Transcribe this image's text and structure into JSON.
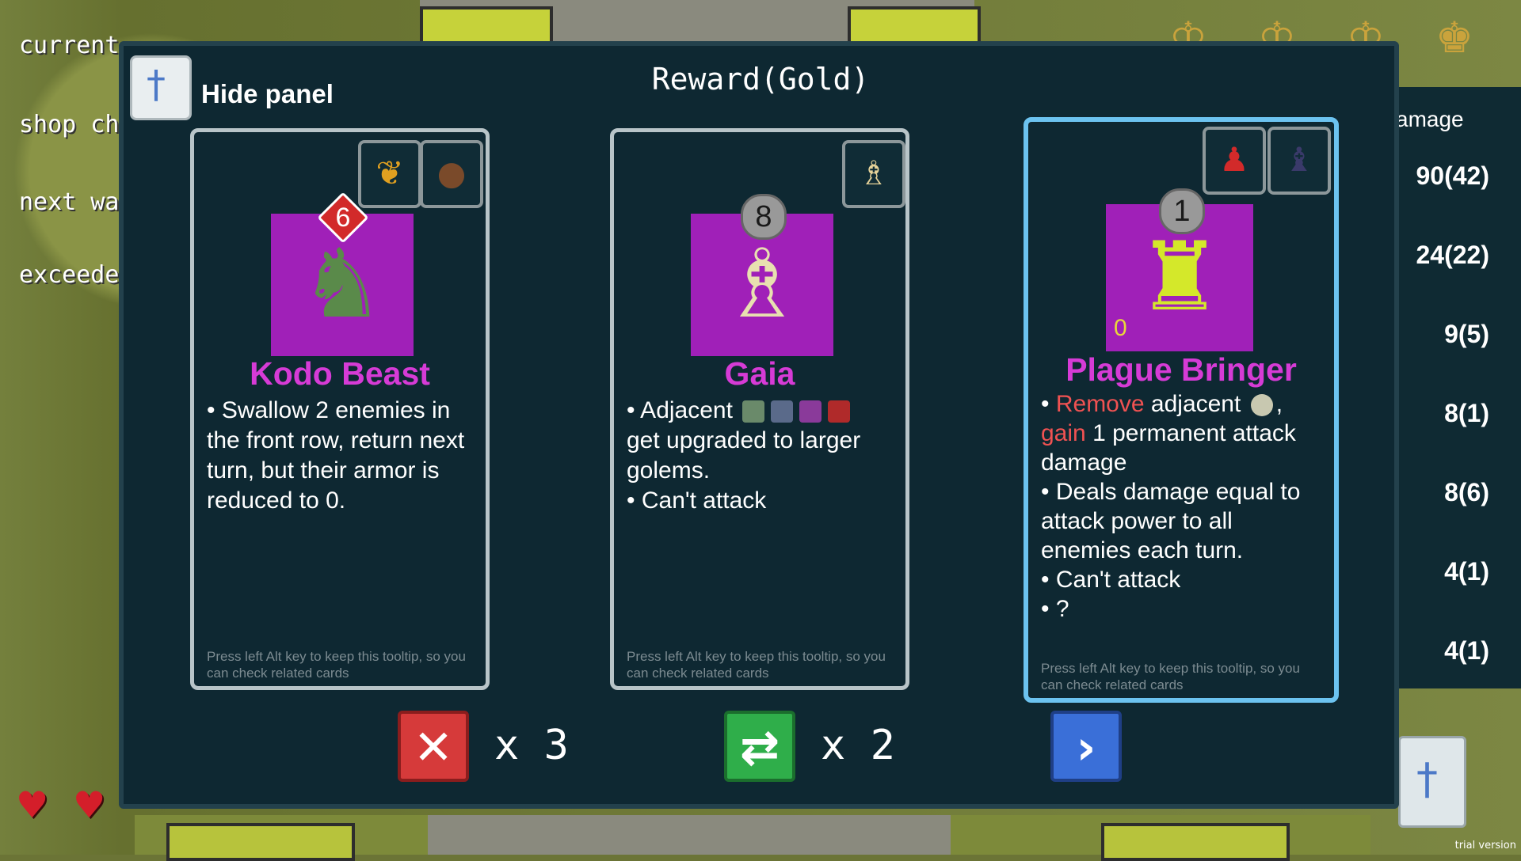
{
  "background": {
    "left_texts": [
      "current",
      "shop ch",
      "next wa",
      "exceede"
    ],
    "damage_title": "amage",
    "damage_values": [
      "90(42)",
      "24(22)",
      "9(5)",
      "8(1)",
      "8(6)",
      "4(1)",
      "4(1)"
    ],
    "trial_label": "trial version"
  },
  "panel": {
    "title": "Reward(Gold)",
    "hide_label": "Hide panel"
  },
  "cards": [
    {
      "name": "Kodo Beast",
      "level": "6",
      "level_style": "diamond",
      "description": "• Swallow 2 enemies in the front row, return next turn, but their armor is reduced to 0.",
      "hint": "Press left Alt key to keep this tooltip, so you can check related cards",
      "tags": [
        "phoenix-icon",
        "bear-icon"
      ]
    },
    {
      "name": "Gaia",
      "level": "8",
      "description_line1_prefix": "• Adjacent",
      "description_rest": "get upgraded to larger golems.",
      "description_line2": "• Can't attack",
      "hint": "Press left Alt key to keep this tooltip, so you can check related cards",
      "tags": [
        "angel-icon"
      ]
    },
    {
      "name": "Plague Bringer",
      "level": "1",
      "counter": "0",
      "remove_word": "Remove",
      "adjacent_word": "adjacent",
      "gain_word": "gain",
      "rest1": "1 permanent attack damage",
      "line2": "• Deals damage equal to attack power to all enemies each turn.",
      "line3": "• Can't attack",
      "line4": "• ?",
      "hint": "Press left Alt key to keep this tooltip, so you can check related cards",
      "tags": [
        "red-figure-icon",
        "priest-icon"
      ]
    }
  ],
  "actions": {
    "reject_count": "x 3",
    "reroll_count": "x 2"
  },
  "colors": {
    "card_name": "#d63bd6",
    "selected_border": "#6cc3f0",
    "reject": "#d63a3a",
    "reroll": "#2fae4a",
    "next": "#3a6fd8"
  }
}
